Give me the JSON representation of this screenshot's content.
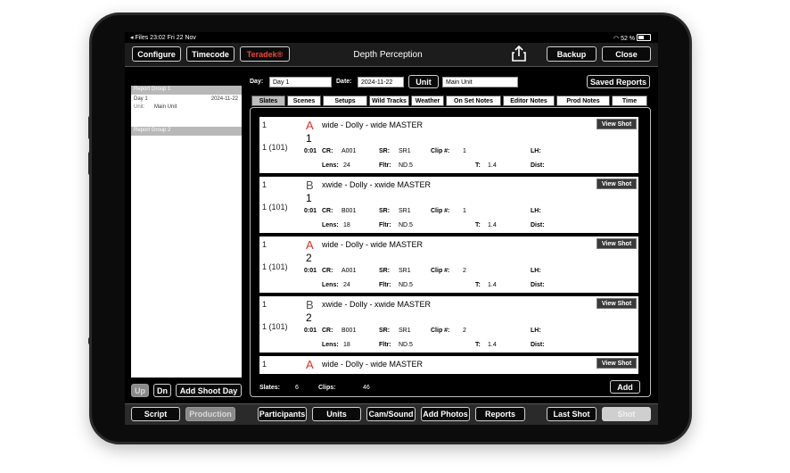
{
  "status": {
    "left": "◂ Files  23:02  Fri 22 Nov",
    "right": "52 %"
  },
  "topbar": {
    "configure": "Configure",
    "timecode": "Timecode",
    "teradek": "Teradek®",
    "title": "Depth Perception",
    "backup": "Backup",
    "close": "Close"
  },
  "filters": {
    "day_label": "Day:",
    "day_value": "Day 1",
    "date_label": "Date:",
    "date_value": "2024-11-22",
    "unit_button": "Unit",
    "unit_value": "Main Unit",
    "saved_reports": "Saved Reports"
  },
  "left_panel": {
    "group1": "Report Group 1",
    "day": "Day 1",
    "date": "2024-11-22",
    "unit_label": "Unit:",
    "unit_value": "Main Unit",
    "group2": "Report Group 2",
    "up": "Up",
    "dn": "Dn",
    "add_shoot_day": "Add Shoot Day"
  },
  "tabs": [
    "Slates",
    "Scenes",
    "Setups",
    "Wild Tracks",
    "Weather",
    "On Set Notes",
    "Editor Notes",
    "Prod Notes",
    "Time"
  ],
  "slates": [
    {
      "scene": "1",
      "setup": "1 (101)",
      "cam": "A",
      "cam_color": "#d9302a",
      "desc": "wide - Dolly - wide MASTER",
      "take": "1",
      "time": "0:01",
      "cr": "A001",
      "sr": "SR1",
      "clip": "1",
      "lens": "24",
      "fltr": "ND.5",
      "t": "1.4"
    },
    {
      "scene": "1",
      "setup": "1 (101)",
      "cam": "B",
      "cam_color": "#555555",
      "desc": "xwide - Dolly - xwide MASTER",
      "take": "1",
      "time": "0:01",
      "cr": "B001",
      "sr": "SR1",
      "clip": "1",
      "lens": "18",
      "fltr": "ND.5",
      "t": "1.4"
    },
    {
      "scene": "1",
      "setup": "1 (101)",
      "cam": "A",
      "cam_color": "#d9302a",
      "desc": "wide - Dolly - wide MASTER",
      "take": "2",
      "time": "0:01",
      "cr": "A001",
      "sr": "SR1",
      "clip": "2",
      "lens": "24",
      "fltr": "ND.5",
      "t": "1.4"
    },
    {
      "scene": "1",
      "setup": "1 (101)",
      "cam": "B",
      "cam_color": "#555555",
      "desc": "xwide - Dolly - xwide MASTER",
      "take": "2",
      "time": "0:01",
      "cr": "B001",
      "sr": "SR1",
      "clip": "2",
      "lens": "18",
      "fltr": "ND.5",
      "t": "1.4"
    },
    {
      "scene": "1",
      "setup": "",
      "cam": "A",
      "cam_color": "#d9302a",
      "desc": "wide - Dolly - wide MASTER",
      "take": "",
      "time": "",
      "cr": "",
      "sr": "",
      "clip": "",
      "lens": "",
      "fltr": "",
      "t": ""
    }
  ],
  "labels": {
    "cr": "CR:",
    "sr": "SR:",
    "clip": "Clip #:",
    "lh": "LH:",
    "lens": "Lens:",
    "fltr": "Fltr:",
    "t": "T:",
    "dist": "Dist:",
    "view_shot": "View Shot"
  },
  "footer": {
    "slates_label": "Slates:",
    "slates_value": "6",
    "clips_label": "Clips:",
    "clips_value": "46",
    "add": "Add"
  },
  "bottombar": {
    "script": "Script",
    "production": "Production",
    "participants": "Participants",
    "units": "Units",
    "cam_sound": "Cam/Sound",
    "add_photos": "Add Photos",
    "reports": "Reports",
    "last_shot": "Last Shot",
    "shot": "Shot"
  }
}
